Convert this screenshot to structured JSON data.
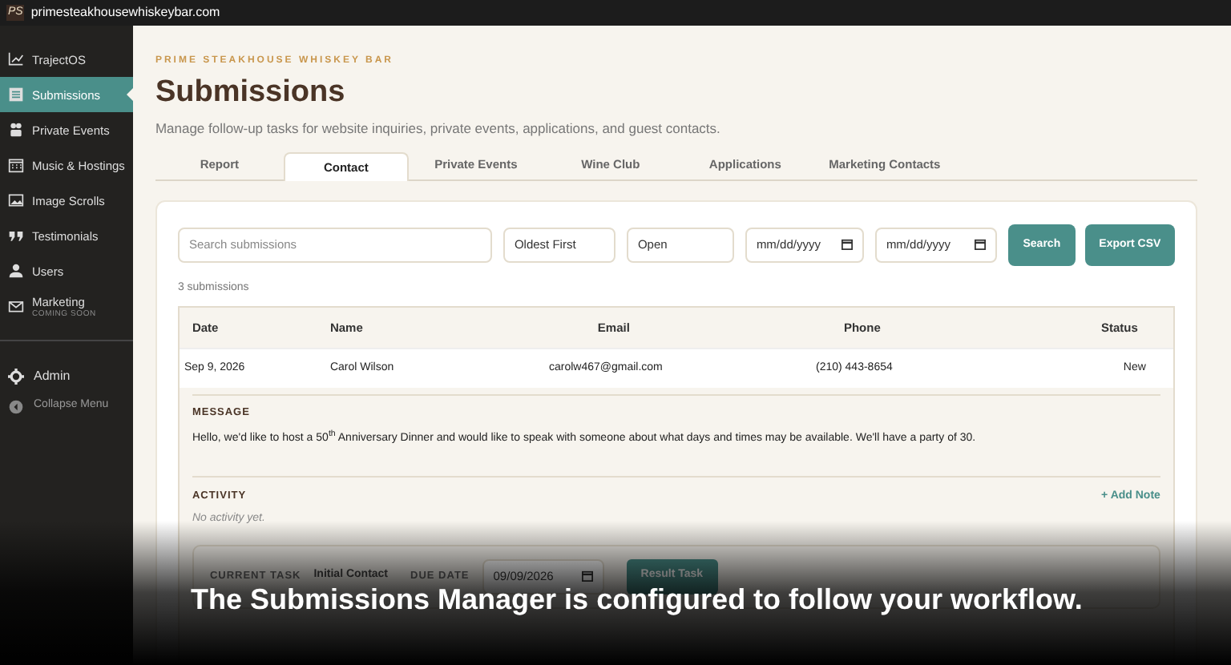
{
  "browser": {
    "url": "primesteakhousewhiskeybar.com",
    "favicon": "PS"
  },
  "sidebar": {
    "items": [
      {
        "label": "TrajectOS",
        "selected": false
      },
      {
        "label": "Submissions",
        "selected": true
      },
      {
        "label": "Private Events",
        "selected": false
      },
      {
        "label": "Music & Hostings",
        "selected": false
      },
      {
        "label": "Image Scrolls",
        "selected": false
      },
      {
        "label": "Testimonials",
        "selected": false
      },
      {
        "label": "Users",
        "selected": false
      },
      {
        "label": "Marketing",
        "selected": false,
        "note": "COMING SOON"
      }
    ],
    "bottom": [
      {
        "label": "Admin"
      },
      {
        "label": "Collapse Menu"
      }
    ]
  },
  "header": {
    "brand": "PRIME STEAKHOUSE WHISKEY BAR",
    "title": "Submissions",
    "subtitle": "Manage follow-up tasks for website inquiries, private events, applications, and guest contacts."
  },
  "tabs": [
    {
      "label": "Report",
      "selected": false
    },
    {
      "label": "Contact",
      "selected": true
    },
    {
      "label": "Private Events",
      "selected": false
    },
    {
      "label": "Wine Club",
      "selected": false
    },
    {
      "label": "Applications",
      "selected": false
    },
    {
      "label": "Marketing Contacts",
      "selected": false
    }
  ],
  "filters": {
    "search": {
      "placeholder": "Search submissions"
    },
    "sort": "Oldest First",
    "status": "Open",
    "date_from": "mm/dd/yyyy",
    "date_to": "mm/dd/yyyy",
    "buttons": [
      "Search",
      "Export CSV"
    ]
  },
  "count": "3 submissions",
  "table": {
    "columns": [
      "Date",
      "Name",
      "Email",
      "Phone",
      "Status"
    ],
    "rows": [
      {
        "cells": [
          "Sep 9, 2026",
          "Carol Wilson",
          "carolw467@gmail.com",
          "(210) 443-8654",
          "New"
        ]
      }
    ]
  },
  "detail": {
    "message_label": "MESSAGE",
    "message": "Hello, we'd like to host a 50$^{th}$ Anniversary Dinner and would like to speak with someone about what days and times may be available. We'll have a party of 30.",
    "activity_label": "ACTIVITY",
    "add_note": "+ Add Note",
    "activity_empty": "No activity yet.",
    "task": {
      "label": "CURRENT TASK",
      "value": "Initial Contact",
      "due_label": "DUE DATE",
      "due": "09/09/2026",
      "button": "Result Task"
    }
  },
  "caption": "The Submissions Manager is configured to follow your workflow."
}
